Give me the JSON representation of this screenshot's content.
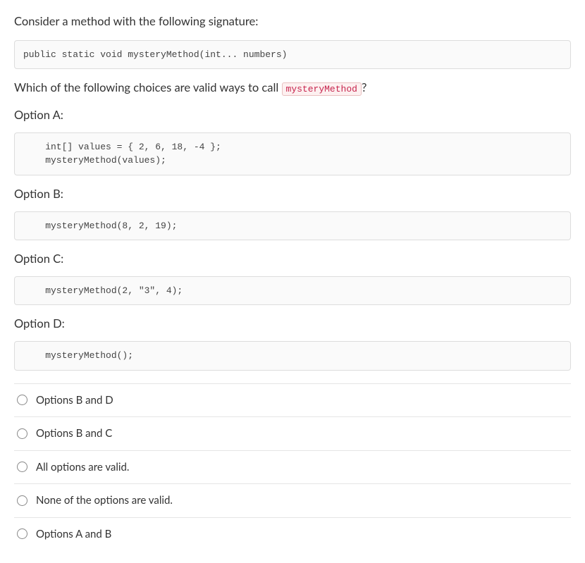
{
  "intro": "Consider a method with the following signature:",
  "signature": "public static void mysteryMethod(int... numbers)",
  "question_prefix": "Which of the following choices are valid ways to call ",
  "inlineCode": "mysteryMethod",
  "question_suffix": "?",
  "options": {
    "a": {
      "label": "Option A:",
      "code": "    int[] values = { 2, 6, 18, -4 };\n    mysteryMethod(values);"
    },
    "b": {
      "label": "Option B:",
      "code": "    mysteryMethod(8, 2, 19);"
    },
    "c": {
      "label": "Option C:",
      "code": "    mysteryMethod(2, \"3\", 4);"
    },
    "d": {
      "label": "Option D:",
      "code": "    mysteryMethod();"
    }
  },
  "answers": [
    "Options B and D",
    "Options B and C",
    "All options are valid.",
    "None of the options are valid.",
    "Options A and B"
  ]
}
